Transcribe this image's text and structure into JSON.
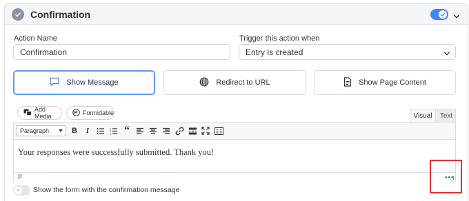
{
  "header": {
    "title": "Confirmation",
    "enabled": true
  },
  "action_name": {
    "label": "Action Name",
    "value": "Confirmation"
  },
  "trigger": {
    "label": "Trigger this action when",
    "value": "Entry is created"
  },
  "action_types": [
    {
      "label": "Show Message",
      "icon": "message-bubble-icon",
      "active": true
    },
    {
      "label": "Redirect to URL",
      "icon": "globe-icon",
      "active": false
    },
    {
      "label": "Show Page Content",
      "icon": "document-icon",
      "active": false
    }
  ],
  "editor": {
    "add_media_label": "Add Media",
    "formidable_label": "Formidable",
    "tab_visual": "Visual",
    "tab_text": "Text",
    "format_value": "Paragraph",
    "content": "Your responses were successfully submitted. Thank you!",
    "path": "P",
    "more_label": "•••"
  },
  "show_form": {
    "label": "Show the form with the confirmation message",
    "enabled": false
  },
  "colors": {
    "accent": "#4286f4",
    "highlight_box": "#e12f2f"
  }
}
